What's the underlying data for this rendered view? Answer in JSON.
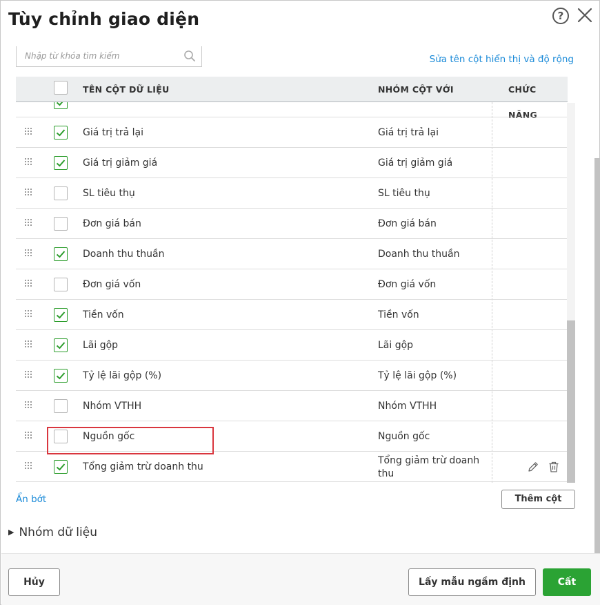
{
  "dialog": {
    "title": "Tùy chỉnh giao diện",
    "help_label": "?"
  },
  "search": {
    "placeholder": "Nhập từ khóa tìm kiếm",
    "value": ""
  },
  "rename_link": "Sửa tên cột hiển thị và độ rộng",
  "table": {
    "headers": {
      "column_name": "TÊN CỘT DỮ LIỆU",
      "group_with": "NHÓM CỘT VỚI",
      "actions": "CHỨC NĂNG"
    },
    "rows": [
      {
        "name": "Giá trị trả lại",
        "group": "Giá trị trả lại",
        "checked": true
      },
      {
        "name": "Giá trị giảm giá",
        "group": "Giá trị giảm giá",
        "checked": true
      },
      {
        "name": "SL tiêu thụ",
        "group": "SL tiêu thụ",
        "checked": false
      },
      {
        "name": "Đơn giá bán",
        "group": "Đơn giá bán",
        "checked": false
      },
      {
        "name": "Doanh thu thuần",
        "group": "Doanh thu thuần",
        "checked": true
      },
      {
        "name": "Đơn giá vốn",
        "group": "Đơn giá vốn",
        "checked": false
      },
      {
        "name": "Tiền vốn",
        "group": "Tiền vốn",
        "checked": true
      },
      {
        "name": "Lãi gộp",
        "group": "Lãi gộp",
        "checked": true
      },
      {
        "name": "Tỷ lệ lãi gộp (%)",
        "group": "Tỷ lệ lãi gộp (%)",
        "checked": true
      },
      {
        "name": "Nhóm VTHH",
        "group": "Nhóm VTHH",
        "checked": false
      },
      {
        "name": "Nguồn gốc",
        "group": "Nguồn gốc",
        "checked": false
      },
      {
        "name": "Tổng giảm trừ doanh thu",
        "group": "Tổng giảm trừ doanh thu",
        "checked": true,
        "custom": true
      }
    ]
  },
  "less_link": "Ẩn bớt",
  "add_column_button": "Thêm cột",
  "data_group": {
    "label": "Nhóm dữ liệu",
    "expanded": false
  },
  "footer": {
    "cancel": "Hủy",
    "default": "Lấy mẫu ngầm định",
    "save": "Cất"
  },
  "colors": {
    "accent_green": "#2ba334",
    "link_blue": "#1a8ad8",
    "highlight_red": "#d9363e",
    "header_bg": "#eceeef"
  }
}
